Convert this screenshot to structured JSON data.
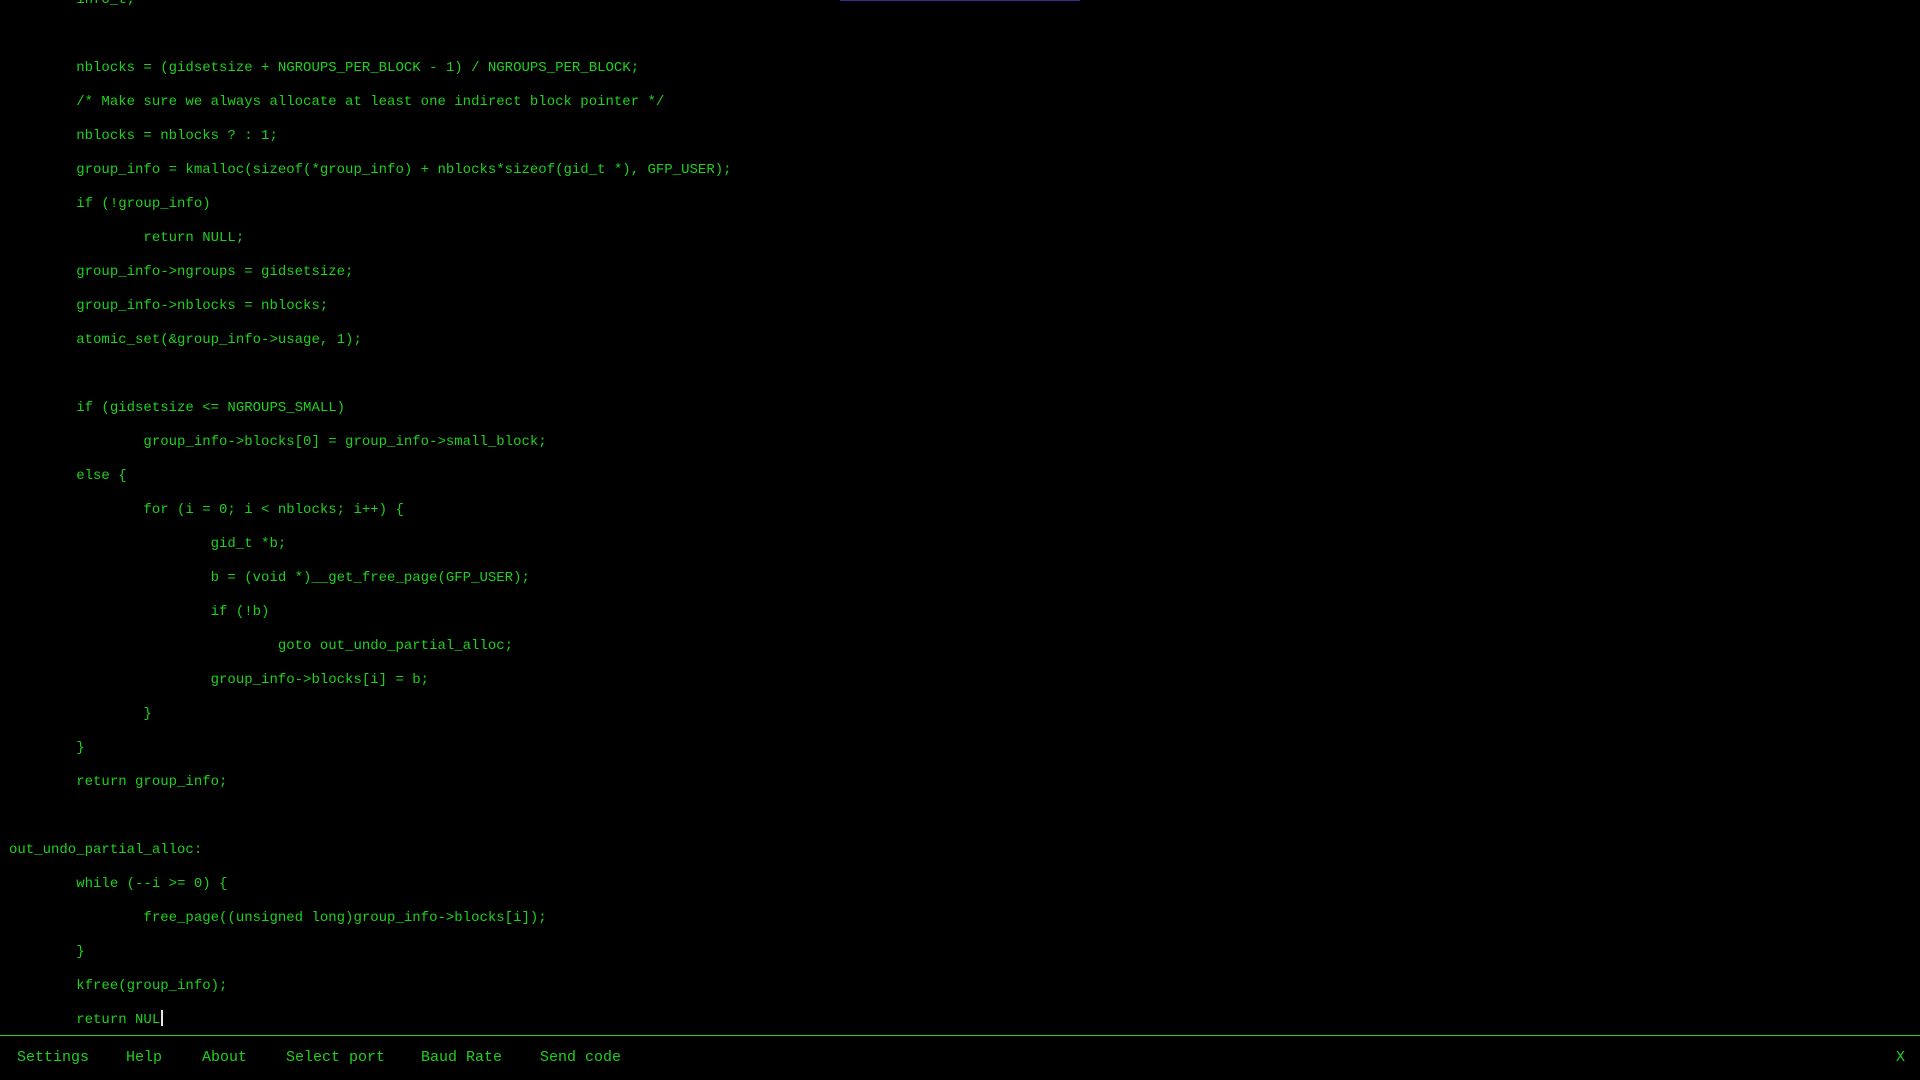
{
  "editor": {
    "lines": [
      "        info_t;",
      "",
      "        nblocks = (gidsetsize + NGROUPS_PER_BLOCK - 1) / NGROUPS_PER_BLOCK;",
      "        /* Make sure we always allocate at least one indirect block pointer */",
      "        nblocks = nblocks ? : 1;",
      "        group_info = kmalloc(sizeof(*group_info) + nblocks*sizeof(gid_t *), GFP_USER);",
      "        if (!group_info)",
      "                return NULL;",
      "        group_info->ngroups = gidsetsize;",
      "        group_info->nblocks = nblocks;",
      "        atomic_set(&group_info->usage, 1);",
      "",
      "        if (gidsetsize <= NGROUPS_SMALL)",
      "                group_info->blocks[0] = group_info->small_block;",
      "        else {",
      "                for (i = 0; i < nblocks; i++) {",
      "                        gid_t *b;",
      "                        b = (void *)__get_free_page(GFP_USER);",
      "                        if (!b)",
      "                                goto out_undo_partial_alloc;",
      "                        group_info->blocks[i] = b;",
      "                }",
      "        }",
      "        return group_info;",
      "",
      "out_undo_partial_alloc:",
      "        while (--i >= 0) {",
      "                free_page((unsigned long)group_info->blocks[i]);",
      "        }",
      "        kfree(group_info);",
      "        return NUL"
    ]
  },
  "menu": {
    "settings": "Settings",
    "help": "Help",
    "about": "About",
    "select_port": "Select port",
    "baud_rate": "Baud Rate",
    "send_code": "Send code",
    "close": "X"
  },
  "colors": {
    "text": "#1fd11f",
    "background": "#000000",
    "cursor": "#e6e6e6"
  }
}
